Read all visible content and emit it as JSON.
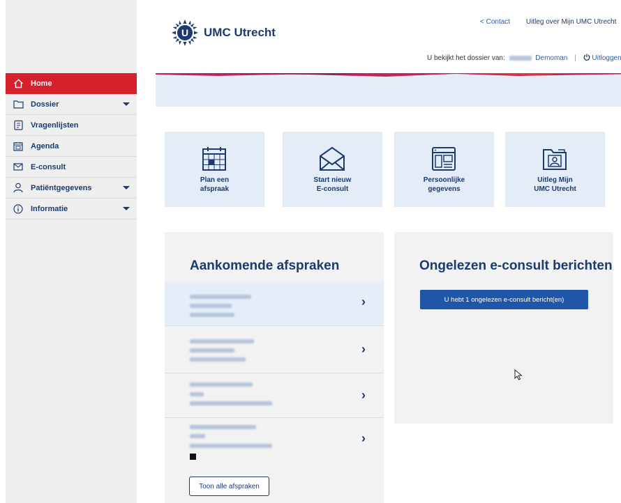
{
  "sidebar": {
    "items": [
      {
        "label": "Home",
        "icon": "home-icon",
        "active": true,
        "caret": false
      },
      {
        "label": "Dossier",
        "icon": "folder-icon",
        "active": false,
        "caret": true
      },
      {
        "label": "Vragenlijsten",
        "icon": "clipboard-icon",
        "active": false,
        "caret": false
      },
      {
        "label": "Agenda",
        "icon": "calendar-icon",
        "active": false,
        "caret": false
      },
      {
        "label": "E-consult",
        "icon": "envelope-icon",
        "active": false,
        "caret": false
      },
      {
        "label": "Patiëntgegevens",
        "icon": "person-icon",
        "active": false,
        "caret": true
      },
      {
        "label": "Informatie",
        "icon": "info-icon",
        "active": false,
        "caret": true
      }
    ]
  },
  "header": {
    "logo_text": "UMC Utrecht",
    "logo_letter": "U",
    "contact_link": "< Contact",
    "about_link": "Uitleg over Mijn UMC Utrecht",
    "dossier_prefix": "U bekijkt het dossier van:",
    "patient_name": "Demoman",
    "separator": "|",
    "logout": "Uitloggen"
  },
  "tiles": [
    {
      "line1": "Plan een",
      "line2": "afspraak",
      "icon": "calendar-grid-icon"
    },
    {
      "line1": "Start nieuw",
      "line2": "E-consult",
      "icon": "envelope-open-icon"
    },
    {
      "line1": "Persoonlijke",
      "line2": "gegevens",
      "icon": "profile-card-icon"
    },
    {
      "line1": "Uitleg Mijn",
      "line2": "UMC Utrecht",
      "icon": "folder-person-icon"
    }
  ],
  "appointments": {
    "title": "Aankomende afspraken",
    "show_all_button": "Toon alle afspraken"
  },
  "econsult": {
    "title": "Ongelezen e-consult berichten",
    "unread_button": "U hebt 1 ongelezen e-consult bericht(en)"
  },
  "colors": {
    "brand_red": "#d6202b",
    "navy": "#1b3b6f",
    "primary_blue": "#1f56a8",
    "tile_bg": "#e4edf7"
  }
}
